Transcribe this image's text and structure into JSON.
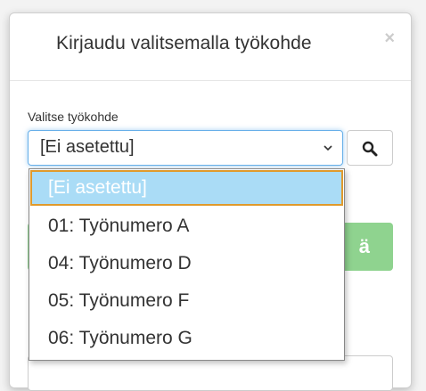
{
  "dialog": {
    "title": "Kirjaudu valitsemalla työkohde",
    "close_label": "×"
  },
  "form": {
    "label": "Valitse työkohde",
    "selected_value": "[Ei asetettu]"
  },
  "dropdown": {
    "options": [
      {
        "label": "[Ei asetettu]",
        "selected": true
      },
      {
        "label": "01: Työnumero A",
        "selected": false
      },
      {
        "label": "04: Työnumero D",
        "selected": false
      },
      {
        "label": "05: Työnumero F",
        "selected": false
      },
      {
        "label": "06: Työnumero G",
        "selected": false
      }
    ]
  },
  "primary_button": {
    "visible_label": "ä"
  },
  "icons": {
    "search": "search-icon",
    "dropdown_arrow": "chevron-down-icon",
    "close": "close-icon"
  },
  "colors": {
    "accent": "#66afe9",
    "option_highlight": "#aadcf6",
    "option_highlight_border": "#e09a2c",
    "primary_button": "#8fd38f"
  }
}
